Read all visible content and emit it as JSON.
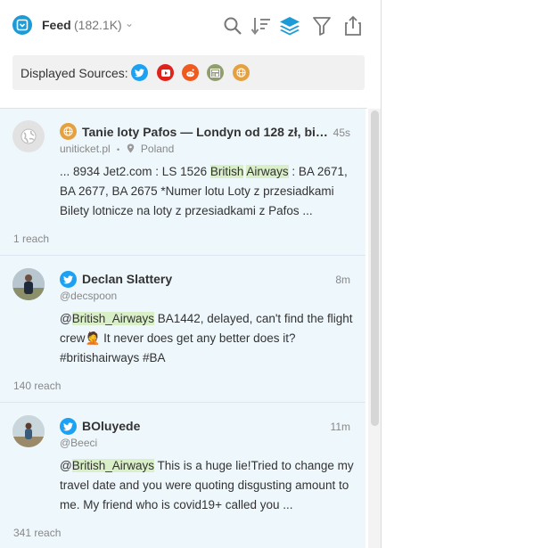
{
  "header": {
    "title": "Feed",
    "count": "(182.1K)",
    "tools": [
      "search-icon",
      "sort-icon",
      "layers-icon",
      "filter-icon",
      "export-icon"
    ]
  },
  "sources": {
    "label": "Displayed Sources:",
    "items": [
      {
        "name": "twitter",
        "color": "#1da1f2"
      },
      {
        "name": "youtube",
        "color": "#e0221b"
      },
      {
        "name": "reddit",
        "color": "#ef5a1f"
      },
      {
        "name": "news",
        "color": "#8f9e6b"
      },
      {
        "name": "web",
        "color": "#e5a040"
      }
    ]
  },
  "items": [
    {
      "source": "web",
      "author": "Tanie loty Pafos — Londyn od 128 zł, bilet…",
      "time": "45s",
      "domain": "uniticket.pl",
      "location": "Poland",
      "text_parts": [
        "... 8934 Jet2.com : LS 1526 ",
        "British",
        " ",
        "Airways",
        " : BA 2671, BA 2677, BA 2675 *Numer lotu Loty z przesiadkami Bilety lotnicze na loty z przesiadkami z Pafos ..."
      ],
      "reach": "1 reach"
    },
    {
      "source": "twitter",
      "author": "Declan Slattery",
      "time": "8m",
      "handle": "@decspoon",
      "text_parts": [
        "@",
        "British_Airways",
        " BA1442, delayed, can't find the flight crew",
        "🤦",
        " It never does get any better does it? #britishairways #BA"
      ],
      "reach": "140 reach"
    },
    {
      "source": "twitter",
      "author": "BOluyede",
      "time": "11m",
      "handle": "@Beeci",
      "text_parts": [
        "@",
        "British_Airways",
        " This is a huge lie!Tried to change my travel date and you were quoting disgusting amount to me. My friend who is covid19+ called you ..."
      ],
      "reach": "341 reach"
    }
  ]
}
